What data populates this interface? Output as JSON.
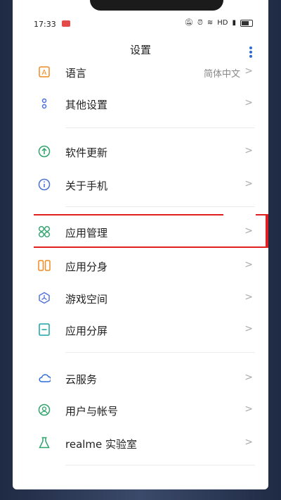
{
  "status": {
    "time": "17:33",
    "network": "HD"
  },
  "header": {
    "title": "设置"
  },
  "items": [
    {
      "label": "语言",
      "value": "简体中文",
      "icon": "language-icon",
      "color": "#f08a22"
    },
    {
      "label": "其他设置",
      "icon": "more-settings-icon",
      "color": "#4a6fd8"
    },
    {
      "label": "软件更新",
      "icon": "update-icon",
      "color": "#2fa36b"
    },
    {
      "label": "关于手机",
      "icon": "info-icon",
      "color": "#4a6fd8"
    },
    {
      "label": "应用管理",
      "icon": "app-management-icon",
      "color": "#2fa36b"
    },
    {
      "label": "应用分身",
      "icon": "app-clone-icon",
      "color": "#f08a22"
    },
    {
      "label": "游戏空间",
      "icon": "game-space-icon",
      "color": "#4a6fd8"
    },
    {
      "label": "应用分屏",
      "icon": "split-screen-icon",
      "color": "#19a3a3"
    },
    {
      "label": "云服务",
      "icon": "cloud-icon",
      "color": "#2a6bd8"
    },
    {
      "label": "用户与帐号",
      "icon": "user-account-icon",
      "color": "#2fa36b"
    },
    {
      "label": "realme 实验室",
      "icon": "lab-icon",
      "color": "#2fa36b"
    }
  ],
  "chevron": ">"
}
